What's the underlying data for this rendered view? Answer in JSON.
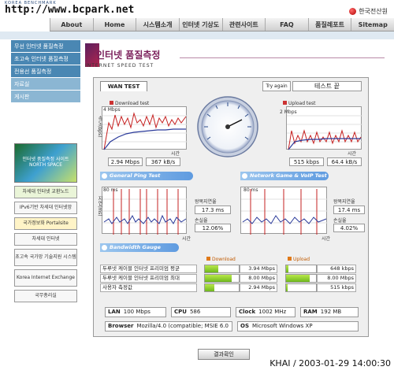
{
  "header": {
    "logo_small": "KOREA BENCHMARK",
    "site_url": "http://www.bcpark.net",
    "org_name": "한국전산원"
  },
  "nav": [
    "About",
    "Home",
    "시스템소개",
    "인터넷 기상도",
    "관련사이트",
    "FAQ",
    "품질레포트",
    "Sitemap"
  ],
  "sidebar": [
    "무선 인터넷 품질측정",
    "초고속 인터넷 품질측정",
    "전용선 품질측정",
    "자료실",
    "게시판"
  ],
  "ads": {
    "big": "인터넷 품질측정 사이트 NORTH SPACE",
    "items": [
      "차세대 인터넷 교환노드",
      "IPv6기반 차세대 인터넷망",
      "국가정보화 Portalsite",
      "차세대 인터넷",
      "초고속 국가망 기술지원 시스템",
      "Korea Internet Exchange",
      "국무총리실"
    ]
  },
  "page_title": "인터넷 품질측정",
  "page_subtitle": "INTERNET SPEED TEST",
  "tab": "WAN TEST",
  "try_again": "Try again",
  "status": "테스트 끝",
  "download": {
    "label": "Download test",
    "scale": "4 Mbps",
    "axis_y": "속도(bps)",
    "axis_x": "시간",
    "mbps": "2.94 Mbps",
    "kbs": "367 kB/s"
  },
  "upload": {
    "label": "Upload test",
    "scale": "2 Mbps",
    "axis_y": "속도(bps)",
    "axis_x": "시간",
    "kbps": "515 kbps",
    "kbs": "64.4 kB/s"
  },
  "general_ping": {
    "title": "General Ping Test",
    "scale": "80 ms",
    "axis_y": "지연(ms)",
    "axis_x": "시간",
    "delay_label": "왕복지연율",
    "delay": "17.3 ms",
    "loss_label": "손실율",
    "loss": "12.06%"
  },
  "game_ping": {
    "title": "Network Game & VoIP Test",
    "scale": "80 ms",
    "axis_y": "지연(ms)",
    "axis_x": "시간",
    "delay_label": "왕복지연율",
    "delay": "17.4 ms",
    "loss_label": "손실율",
    "loss": "4.02%"
  },
  "bandwidth": {
    "title": "Bandwidth Gauge",
    "download_header": "Download",
    "upload_header": "Upload",
    "rows": [
      {
        "label": "두루넷 케이블 인터넷 프리미엄 평균",
        "down": "3.94 Mbps",
        "down_fraction": 0.39,
        "up": "648 kbps",
        "up_fraction": 0.08
      },
      {
        "label": "두루넷 케이블 인터넷 프리미엄 최대",
        "down": "8.00 Mbps",
        "down_fraction": 0.8,
        "up": "8.00 Mbps",
        "up_fraction": 0.8
      },
      {
        "label": "사용자 측정값",
        "down": "2.94 Mbps",
        "down_fraction": 0.29,
        "up": "515 kbps",
        "up_fraction": 0.06
      }
    ]
  },
  "system": {
    "lan_label": "LAN",
    "lan": "100 Mbps",
    "cpu_label": "CPU",
    "cpu": "586",
    "clock_label": "Clock",
    "clock": "1002 MHz",
    "ram_label": "RAM",
    "ram": "192 MB",
    "browser_label": "Browser",
    "browser": "Mozilla/4.0 (compatible; MSIE 6.0",
    "os_label": "OS",
    "os": "Microsoft Windows XP"
  },
  "result_button": "결과확인",
  "timestamp": "KHAI / 2003-01-29 14:00:30"
}
